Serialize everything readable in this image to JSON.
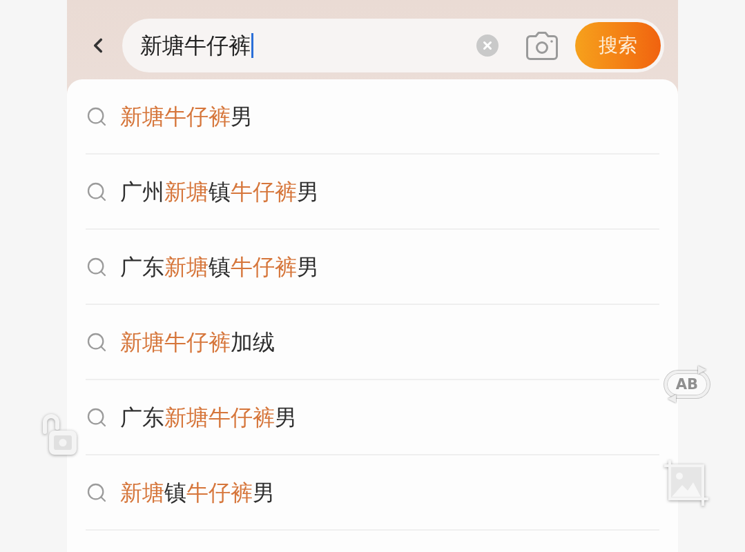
{
  "search_bar": {
    "query": "新塘牛仔裤",
    "focused": true,
    "search_button": "搜索"
  },
  "suggestions": [
    {
      "segments": [
        {
          "text": "新塘牛仔裤",
          "highlighted": true
        },
        {
          "text": "男",
          "highlighted": false
        }
      ]
    },
    {
      "segments": [
        {
          "text": "广州",
          "highlighted": false
        },
        {
          "text": "新塘",
          "highlighted": true
        },
        {
          "text": "镇",
          "highlighted": false
        },
        {
          "text": "牛仔裤",
          "highlighted": true
        },
        {
          "text": "男",
          "highlighted": false
        }
      ]
    },
    {
      "segments": [
        {
          "text": "广东",
          "highlighted": false
        },
        {
          "text": "新塘",
          "highlighted": true
        },
        {
          "text": "镇",
          "highlighted": false
        },
        {
          "text": "牛仔裤",
          "highlighted": true
        },
        {
          "text": "男",
          "highlighted": false
        }
      ]
    },
    {
      "segments": [
        {
          "text": "新塘牛仔裤",
          "highlighted": true
        },
        {
          "text": "加绒",
          "highlighted": false
        }
      ]
    },
    {
      "segments": [
        {
          "text": "广东",
          "highlighted": false
        },
        {
          "text": "新塘牛仔裤",
          "highlighted": true
        },
        {
          "text": "男",
          "highlighted": false
        }
      ]
    },
    {
      "segments": [
        {
          "text": "新塘",
          "highlighted": true
        },
        {
          "text": "镇",
          "highlighted": false
        },
        {
          "text": "牛仔裤",
          "highlighted": true
        },
        {
          "text": "男",
          "highlighted": false
        }
      ]
    }
  ],
  "floating_tools": {
    "translate_label": "AB"
  }
}
